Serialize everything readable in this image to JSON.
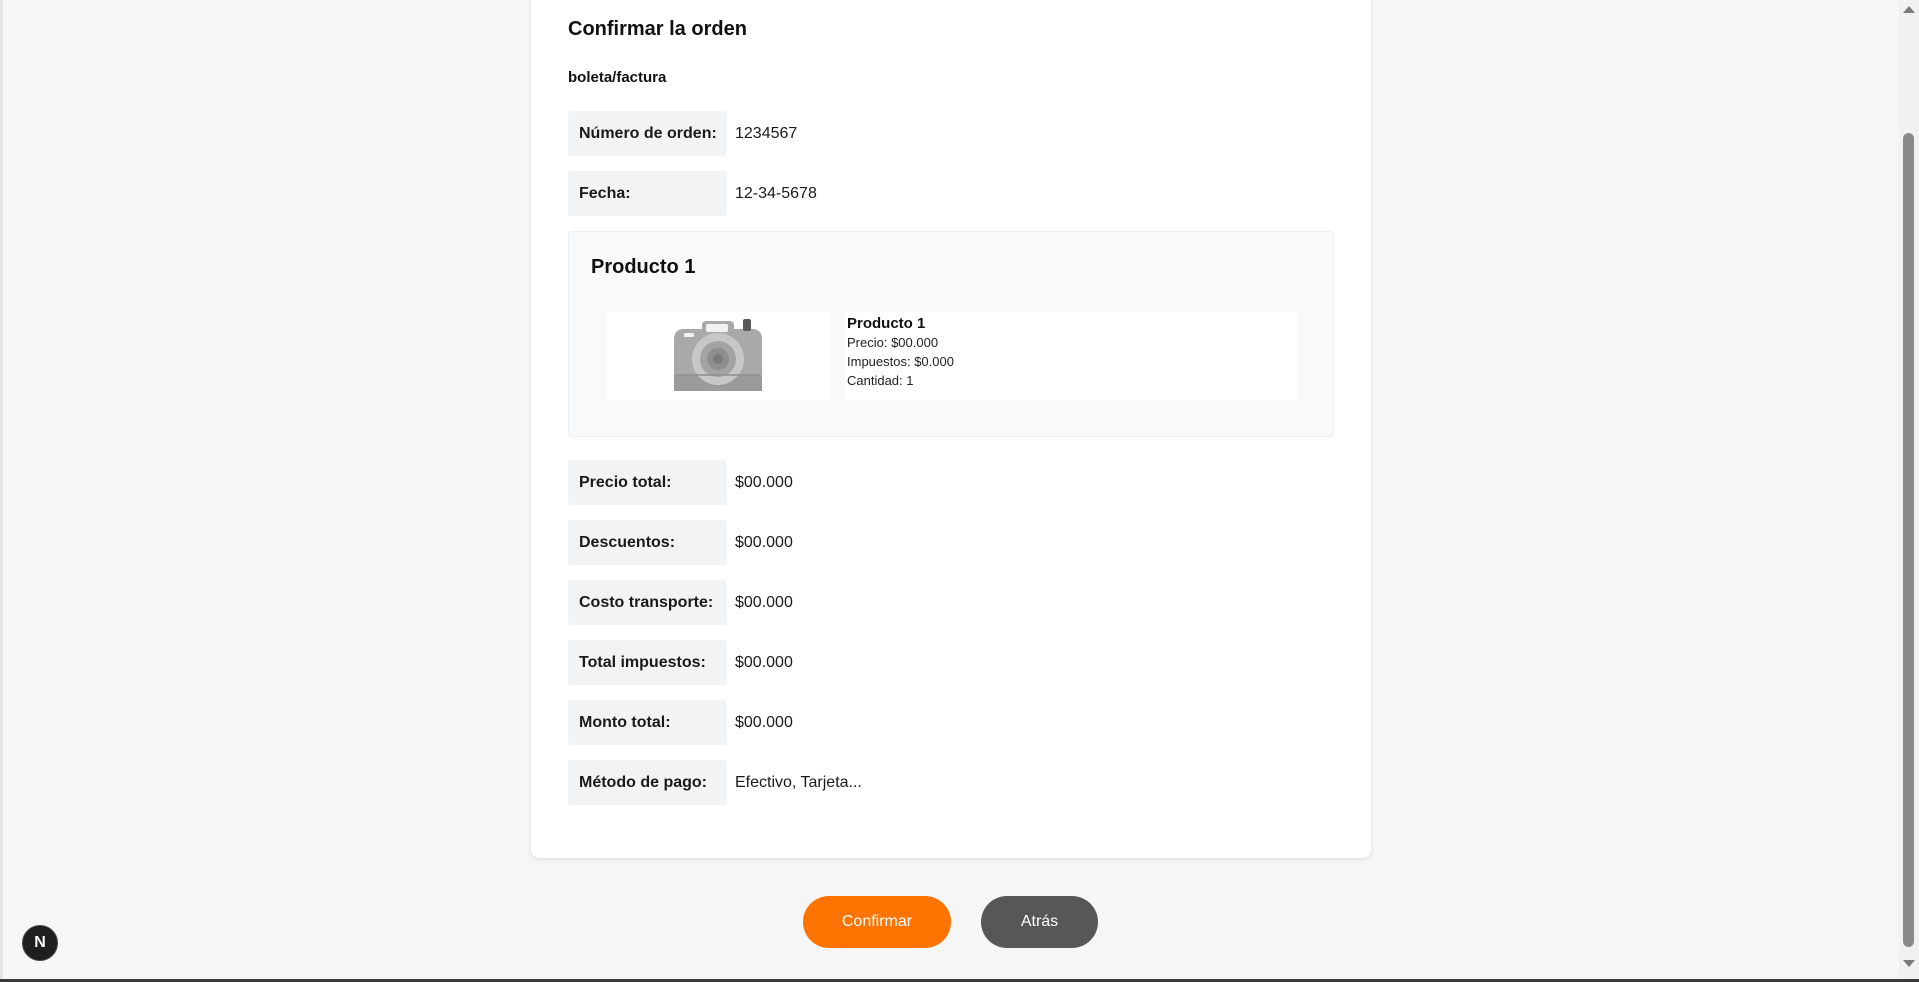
{
  "order": {
    "title": "Confirmar la orden",
    "subtitle": "boleta/factura",
    "number": {
      "label": "Número de orden:",
      "value": "1234567"
    },
    "date": {
      "label": "Fecha:",
      "value": "12-34-5678"
    }
  },
  "product": {
    "heading": "Producto 1",
    "image_icon": "camera-icon",
    "name": "Producto 1",
    "price": "Precio: $00.000",
    "taxes": "Impuestos: $0.000",
    "quantity": "Cantidad: 1"
  },
  "summary": [
    {
      "label": "Precio total:",
      "value": "$00.000"
    },
    {
      "label": "Descuentos:",
      "value": "$00.000"
    },
    {
      "label": "Costo transporte:",
      "value": "$00.000"
    },
    {
      "label": "Total impuestos:",
      "value": "$00.000"
    },
    {
      "label": "Monto total:",
      "value": "$00.000"
    },
    {
      "label": "Método de pago:",
      "value": "Efectivo, Tarjeta..."
    }
  ],
  "actions": {
    "confirm_label": "Confirmar",
    "back_label": "Atrás"
  },
  "badge": {
    "letter": "N"
  },
  "colors": {
    "accent": "#ff7300",
    "secondary": "#575757",
    "label_bg": "#f2f3f5"
  }
}
